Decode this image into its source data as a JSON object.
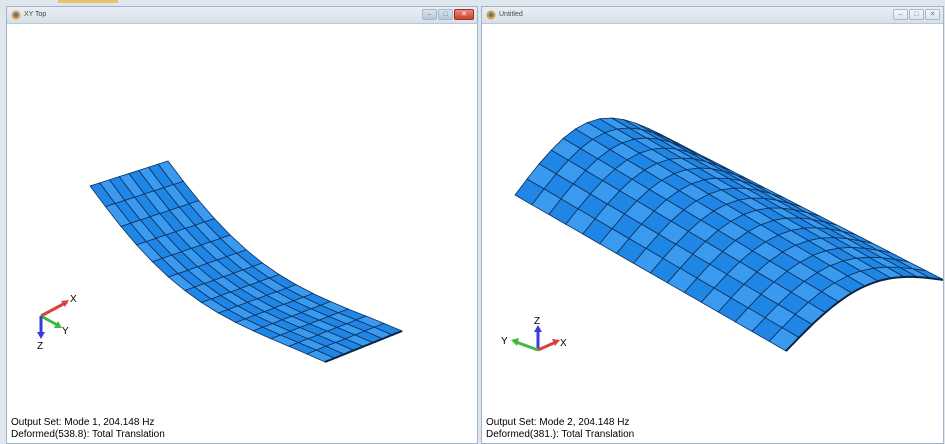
{
  "windows": [
    {
      "title": "XY Top",
      "output_set": "Output Set: Mode 1, 204.148 Hz",
      "deformed": "Deformed(538.8): Total Translation",
      "axis_labels": {
        "x": "X",
        "y": "Y",
        "z": "Z"
      }
    },
    {
      "title": "Untitled",
      "output_set": "Output Set: Mode 2, 204.148 Hz",
      "deformed": "Deformed(381.): Total Translation",
      "axis_labels": {
        "x": "X",
        "y": "Y",
        "z": "Z"
      }
    }
  ],
  "colors": {
    "mesh_fill": "#1f86e6",
    "mesh_fill_light": "#3a9af0",
    "mesh_line": "#0b2f5a",
    "axis_x": "#d94040",
    "axis_y": "#3fb83f",
    "axis_z": "#3a3ad8"
  },
  "icons": {
    "app": "femap-app-icon",
    "minimize": "minimize-icon",
    "maximize": "maximize-icon",
    "close": "close-icon"
  }
}
